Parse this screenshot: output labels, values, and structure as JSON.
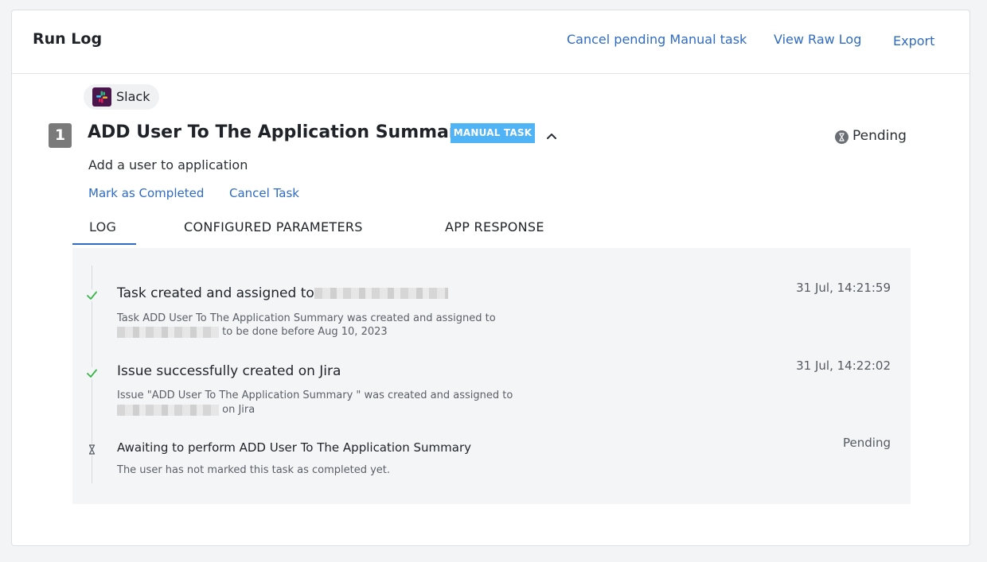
{
  "header": {
    "title": "Run Log",
    "links": {
      "cancel_pending": "Cancel pending Manual task",
      "view_raw_log": "View Raw Log",
      "export": "Export"
    }
  },
  "step": {
    "app_name": "Slack",
    "app_icon": "slack-logo",
    "number": "1",
    "title": "ADD User To The Application Summary",
    "badge": "MANUAL TASK",
    "status": "Pending",
    "status_icon": "hourglass-icon",
    "description": "Add a user to application",
    "actions": {
      "mark_completed": "Mark as Completed",
      "cancel_task": "Cancel Task"
    }
  },
  "tabs": [
    {
      "label": "LOG",
      "active": true
    },
    {
      "label": "CONFIGURED PARAMETERS",
      "active": false
    },
    {
      "label": "APP RESPONSE",
      "active": false
    }
  ],
  "log_entries": [
    {
      "icon": "check-icon",
      "title": "Task created and assigned to",
      "time": "31 Jul, 14:21:59",
      "detail_line1": "Task ADD User To The Application Summary was created and assigned to",
      "detail_line2": "to be done before Aug 10, 2023"
    },
    {
      "icon": "check-icon",
      "title": "Issue successfully created on Jira",
      "time": "31 Jul, 14:22:02",
      "detail_line1": "Issue \"ADD User To The Application Summary \" was created and assigned to",
      "detail_line2": "on Jira"
    },
    {
      "icon": "hourglass-icon",
      "title": "Awaiting to perform ADD User To The Application Summary",
      "time": "Pending",
      "detail_line1": "The user has not marked this task as completed yet."
    }
  ],
  "colors": {
    "link": "#2f6bc4",
    "badge": "#4fb3f6",
    "check": "#3bb54a",
    "slack": "#4a154b"
  }
}
